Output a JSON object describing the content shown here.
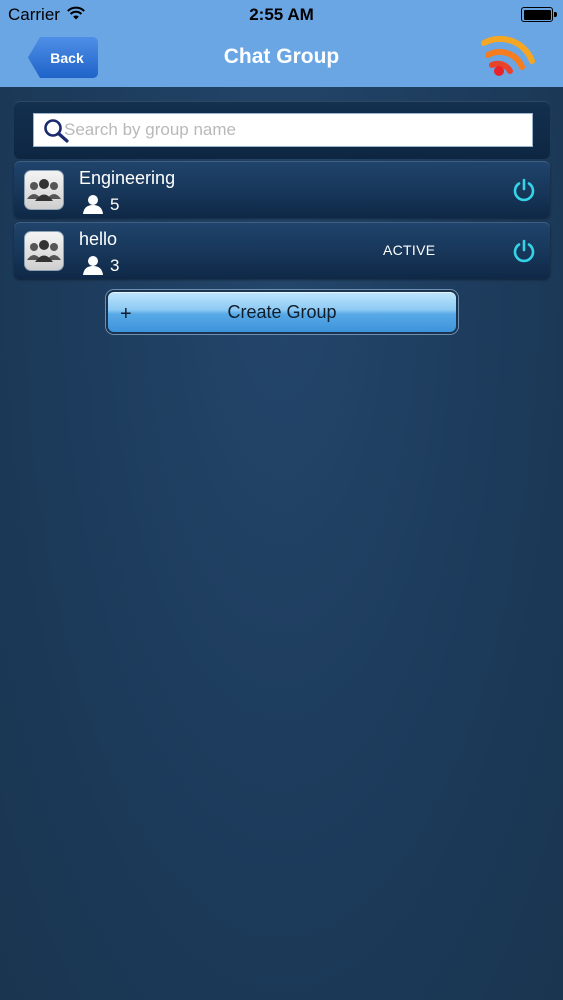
{
  "status_bar": {
    "carrier": "Carrier",
    "time": "2:55 AM"
  },
  "nav": {
    "back_label": "Back",
    "title": "Chat Group",
    "right_icon": "rss-feed-icon"
  },
  "search": {
    "placeholder": "Search by group name",
    "value": ""
  },
  "groups": [
    {
      "name": "Engineering",
      "member_count": "5",
      "status": "",
      "icon": "power-icon"
    },
    {
      "name": "hello",
      "member_count": "3",
      "status": "ACTIVE",
      "icon": "power-icon"
    }
  ],
  "create_button": {
    "icon": "+",
    "label": "Create Group"
  },
  "colors": {
    "nav_bar": "#6aa6e4",
    "background": "#1d3a5c",
    "power_icon": "#35d3e8",
    "back_button": "#2a70d4"
  }
}
